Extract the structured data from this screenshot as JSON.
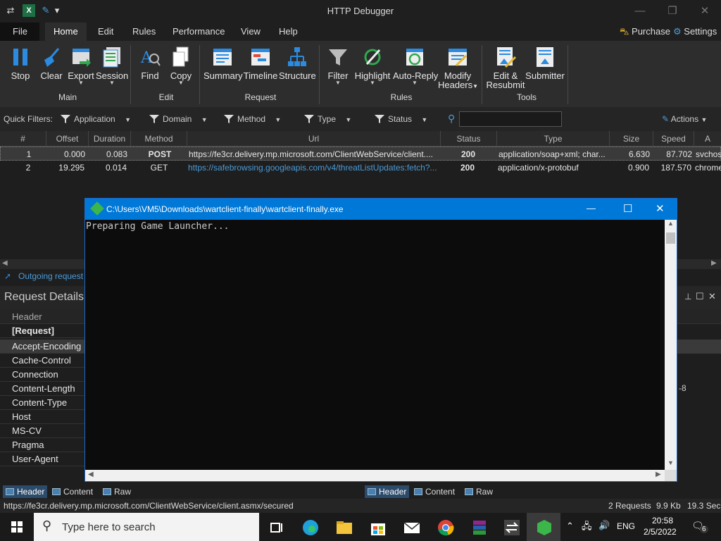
{
  "window": {
    "title": "HTTP Debugger",
    "quick_access": [
      "⇄",
      "X",
      "✎",
      "▾"
    ],
    "controls": {
      "minimize": "—",
      "maximize": "❐",
      "close": "✕"
    }
  },
  "menu": {
    "file": "File",
    "tabs": [
      "Home",
      "Edit",
      "Rules",
      "Performance",
      "View",
      "Help"
    ],
    "purchase": "Purchase",
    "settings": "Settings"
  },
  "ribbon": {
    "buttons": [
      {
        "name": "stop",
        "label": "Stop"
      },
      {
        "name": "clear",
        "label": "Clear"
      },
      {
        "name": "export",
        "label": "Export"
      },
      {
        "name": "session",
        "label": "Session"
      },
      {
        "name": "find",
        "label": "Find"
      },
      {
        "name": "copy",
        "label": "Copy"
      },
      {
        "name": "summary",
        "label": "Summary"
      },
      {
        "name": "timeline",
        "label": "Timeline"
      },
      {
        "name": "structure",
        "label": "Structure"
      },
      {
        "name": "filter",
        "label": "Filter"
      },
      {
        "name": "highlight",
        "label": "Highlight"
      },
      {
        "name": "auto-reply",
        "label": "Auto-Reply"
      },
      {
        "name": "modify-headers",
        "label": "Modify",
        "label2": "Headers"
      },
      {
        "name": "edit-resubmit",
        "label": "Edit &",
        "label2": "Resubmit"
      },
      {
        "name": "submitter",
        "label": "Submitter"
      }
    ],
    "groups": [
      "Main",
      "Edit",
      "Request",
      "Rules",
      "Tools"
    ]
  },
  "filters": {
    "label": "Quick Filters:",
    "items": [
      "Application",
      "Domain",
      "Method",
      "Type",
      "Status"
    ],
    "actions": "Actions"
  },
  "grid": {
    "columns": [
      "#",
      "Offset",
      "Duration",
      "Method",
      "Url",
      "Status",
      "Type",
      "Size",
      "Speed",
      "A"
    ],
    "rows": [
      {
        "num": "1",
        "offset": "0.000",
        "duration": "0.083",
        "method": "POST",
        "url": "https://fe3cr.delivery.mp.microsoft.com/ClientWebService/client....",
        "status": "200",
        "type": "application/soap+xml; char...",
        "size": "6.630",
        "speed": "87.702",
        "app": "svchost"
      },
      {
        "num": "2",
        "offset": "19.295",
        "duration": "0.014",
        "method": "GET",
        "url": "https://safebrowsing.googleapis.com/v4/threatListUpdates:fetch?...",
        "status": "200",
        "type": "application/x-protobuf",
        "size": "0.900",
        "speed": "187.570",
        "app": "chrome"
      }
    ]
  },
  "outgoing": "Outgoing request",
  "details": {
    "title": "Request Details",
    "header_col": "Header",
    "rows": [
      "[Request]",
      "Accept-Encoding",
      "Cache-Control",
      "Connection",
      "Content-Length",
      "Content-Type",
      "Host",
      "MS-CV",
      "Pragma",
      "User-Agent"
    ],
    "side_value": "-8",
    "pin": "📌",
    "float": "☐",
    "close": "✕"
  },
  "bottom_tabs_left": [
    "Header",
    "Content",
    "Raw"
  ],
  "bottom_tabs_right": [
    "Header",
    "Content",
    "Raw"
  ],
  "status": {
    "url": "https://fe3cr.delivery.mp.microsoft.com/ClientWebService/client.asmx/secured",
    "requests": "2 Requests",
    "size": "9.9 Kb",
    "time": "19.3 Sec"
  },
  "console": {
    "title": "C:\\Users\\VM5\\Downloads\\wartclient-finally\\wartclient-finally.exe",
    "text": "Preparing Game Launcher...",
    "minimize": "—",
    "maximize": "☐",
    "close": "✕"
  },
  "taskbar": {
    "search_placeholder": "Type here to search",
    "lang": "ENG",
    "time": "20:58",
    "date": "2/5/2022",
    "notifications": "6"
  },
  "colors": {
    "accent": "#0078d7",
    "link": "#4a9bd8",
    "ribbon_icon": "#2a8be0"
  }
}
